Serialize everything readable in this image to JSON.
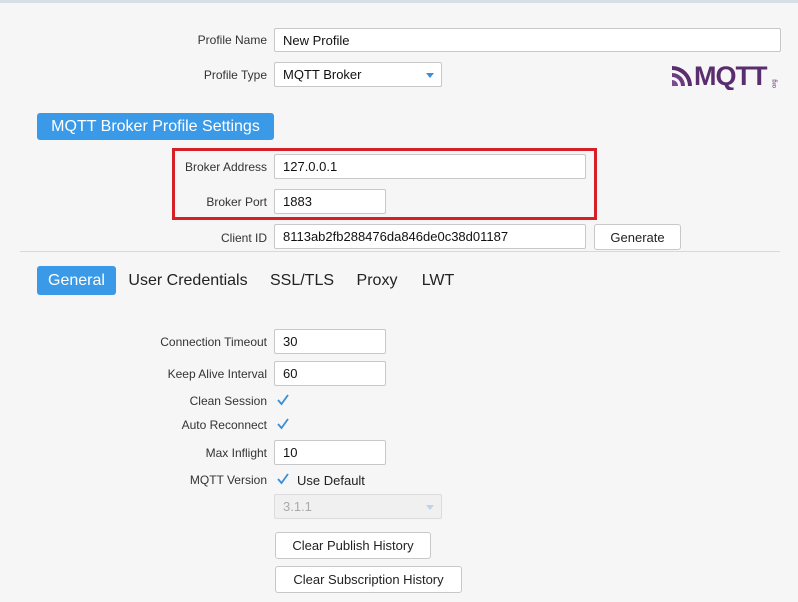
{
  "profile": {
    "name_label": "Profile Name",
    "name_value": "New Profile",
    "type_label": "Profile Type",
    "type_value": "MQTT Broker"
  },
  "logo": {
    "text": "MQTT",
    "subtext": "org"
  },
  "section": {
    "title": "MQTT Broker Profile Settings"
  },
  "broker": {
    "address_label": "Broker Address",
    "address_value": "127.0.0.1",
    "port_label": "Broker Port",
    "port_value": "1883",
    "client_id_label": "Client ID",
    "client_id_value": "8113ab2fb288476da846de0c38d01187",
    "generate_label": "Generate"
  },
  "tabs": [
    {
      "label": "General",
      "active": true
    },
    {
      "label": "User Credentials",
      "active": false
    },
    {
      "label": "SSL/TLS",
      "active": false
    },
    {
      "label": "Proxy",
      "active": false
    },
    {
      "label": "LWT",
      "active": false
    }
  ],
  "general": {
    "connection_timeout_label": "Connection Timeout",
    "connection_timeout_value": "30",
    "keep_alive_label": "Keep Alive Interval",
    "keep_alive_value": "60",
    "clean_session_label": "Clean Session",
    "clean_session_checked": true,
    "auto_reconnect_label": "Auto Reconnect",
    "auto_reconnect_checked": true,
    "max_inflight_label": "Max Inflight",
    "max_inflight_value": "10",
    "mqtt_version_label": "MQTT Version",
    "use_default_label": "Use Default",
    "use_default_checked": true,
    "version_value": "3.1.1",
    "clear_publish_label": "Clear Publish History",
    "clear_subscription_label": "Clear Subscription History"
  },
  "colors": {
    "accent": "#3a9ae8",
    "highlight": "#d42026",
    "logo": "#5a2d6e"
  }
}
